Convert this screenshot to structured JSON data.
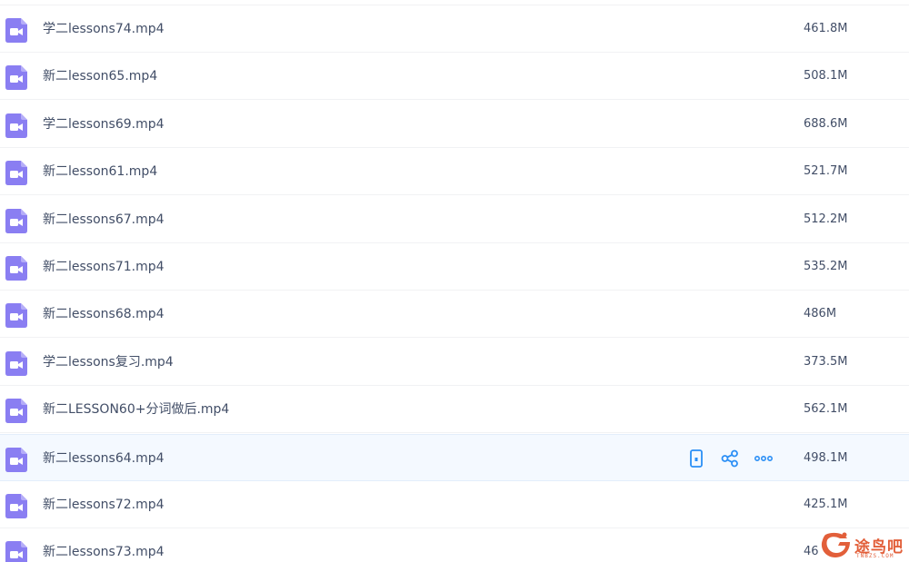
{
  "files": [
    {
      "name": "学二lessons74.mp4",
      "size": "461.8M",
      "icon": "video-file-icon"
    },
    {
      "name": "新二lesson65.mp4",
      "size": "508.1M",
      "icon": "video-file-icon"
    },
    {
      "name": "学二lessons69.mp4",
      "size": "688.6M",
      "icon": "video-file-icon"
    },
    {
      "name": "新二lesson61.mp4",
      "size": "521.7M",
      "icon": "video-file-icon"
    },
    {
      "name": "新二lessons67.mp4",
      "size": "512.2M",
      "icon": "video-file-icon"
    },
    {
      "name": "新二lessons71.mp4",
      "size": "535.2M",
      "icon": "video-file-icon"
    },
    {
      "name": "新二lessons68.mp4",
      "size": "486M",
      "icon": "video-file-icon"
    },
    {
      "name": "学二lessons复习.mp4",
      "size": "373.5M",
      "icon": "video-file-icon"
    },
    {
      "name": "新二LESSON60+分词做后.mp4",
      "size": "562.1M",
      "icon": "video-file-icon"
    },
    {
      "name": "新二lessons64.mp4",
      "size": "498.1M",
      "icon": "video-file-icon",
      "hovered": true
    },
    {
      "name": "新二lessons72.mp4",
      "size": "425.1M",
      "icon": "video-file-icon"
    },
    {
      "name": "新二lessons73.mp4",
      "size": "46",
      "icon": "video-file-icon"
    }
  ],
  "row_actions": [
    {
      "icon": "phone-icon"
    },
    {
      "icon": "share-icon"
    },
    {
      "icon": "more-icon"
    }
  ],
  "watermark": {
    "text": "途鸟吧",
    "sub": "TNBZS.COM"
  },
  "colors": {
    "icon_purple": "#8a7ef2",
    "action_blue": "#2b8ff6",
    "text": "#424e67",
    "hover_bg": "#f4f9ff",
    "divider": "#f1f2f4",
    "watermark": "#e25f3a"
  }
}
